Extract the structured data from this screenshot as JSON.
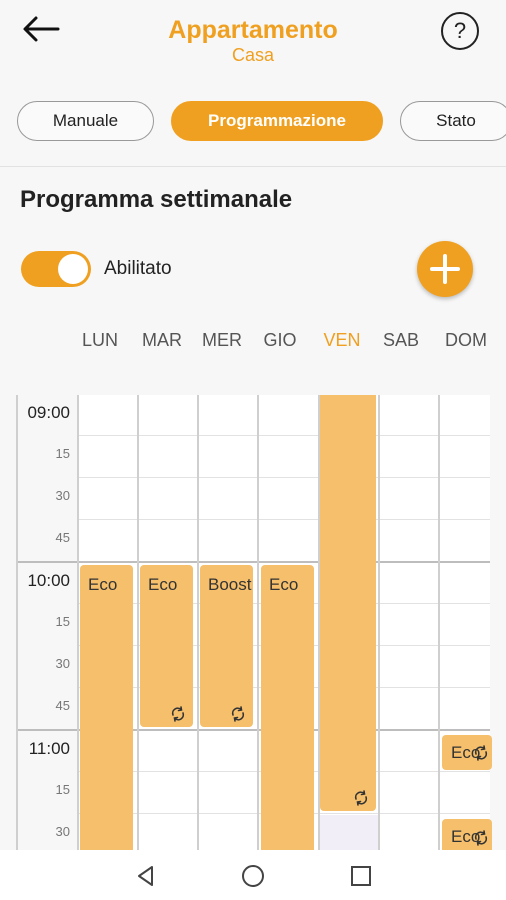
{
  "header": {
    "title": "Appartamento",
    "subtitle": "Casa",
    "help_label": "?"
  },
  "tabs": [
    {
      "label": "Manuale",
      "active": false
    },
    {
      "label": "Programmazione",
      "active": true
    },
    {
      "label": "Stato",
      "active": false
    }
  ],
  "section_title": "Programma settimanale",
  "toggle": {
    "label": "Abilitato",
    "on": true
  },
  "days": [
    "LUN",
    "MAR",
    "MER",
    "GIO",
    "VEN",
    "SAB",
    "DOM"
  ],
  "current_day": "VEN",
  "time_labels": [
    "09:00",
    "15",
    "30",
    "45",
    "10:00",
    "15",
    "30",
    "45",
    "11:00",
    "15",
    "30"
  ],
  "blocks": [
    {
      "day": "LUN",
      "label": "Eco",
      "start": "10:00",
      "repeat": false
    },
    {
      "day": "MAR",
      "label": "Eco",
      "start": "10:00",
      "end": "10:45",
      "repeat": true
    },
    {
      "day": "MER",
      "label": "Boost",
      "start": "10:00",
      "end": "10:45",
      "repeat": true
    },
    {
      "day": "GIO",
      "label": "Eco",
      "start": "10:00",
      "repeat": false
    },
    {
      "day": "VEN",
      "label": "",
      "end": "11:15",
      "repeat": true
    },
    {
      "day": "DOM",
      "label": "Eco",
      "start": "11:00",
      "repeat": true
    },
    {
      "day": "DOM",
      "label": "Eco",
      "start": "11:25",
      "repeat": true
    }
  ],
  "colors": {
    "accent": "#f0a020",
    "block": "#f5bf6c"
  }
}
